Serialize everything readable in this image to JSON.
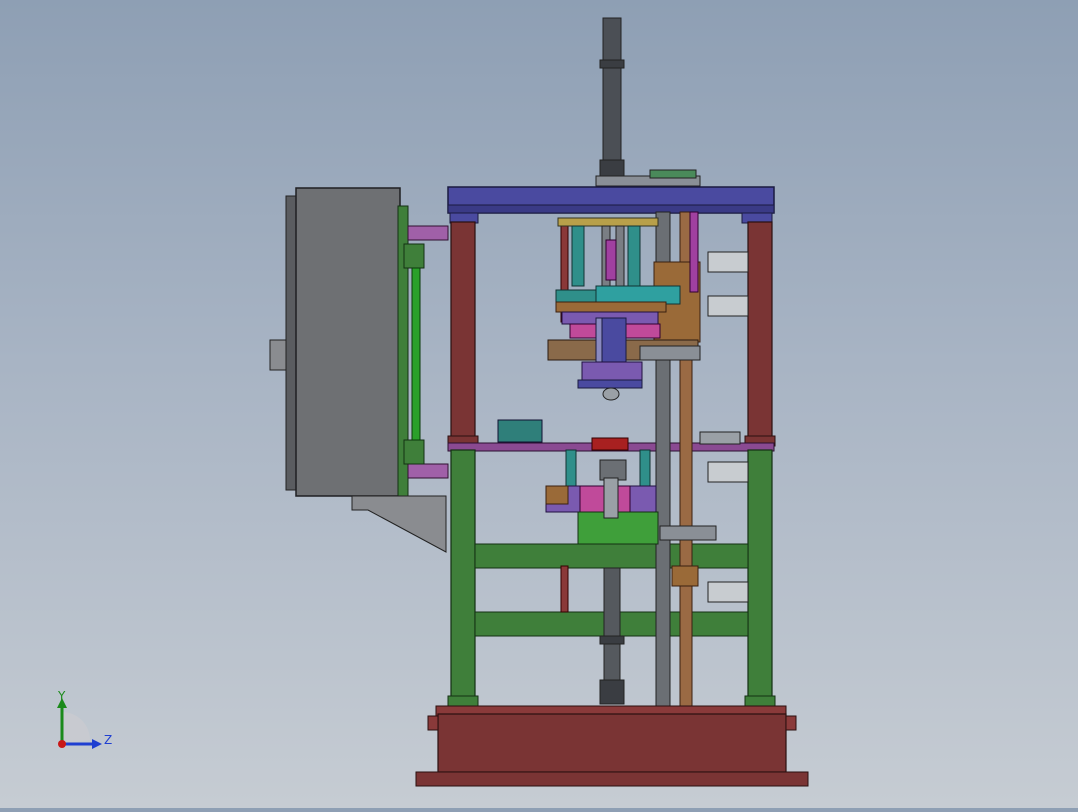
{
  "triad": {
    "y_label": "Y",
    "z_label": "Z",
    "y_color": "#1b8a1b",
    "z_color": "#1f3fd1",
    "x_color": "#c81818"
  },
  "colors": {
    "frame_green": "#3f7f3a",
    "frame_red": "#7a3434",
    "top_plate_blue": "#4a4aa0",
    "base_red": "#7a3434",
    "cabinet_grey": "#6e7073",
    "rail_purple": "#8a4a92",
    "cylinder_dark": "#4a4e54"
  }
}
